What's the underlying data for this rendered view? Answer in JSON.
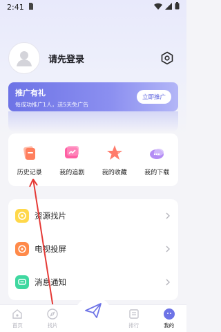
{
  "status_bar": {
    "time": "2:41"
  },
  "profile": {
    "login_text": "请先登录"
  },
  "promo": {
    "title": "推广有礼",
    "subtitle": "每成功推广1人，送5天免广告",
    "button": "立即推广"
  },
  "quick_actions": [
    {
      "label": "历史记录",
      "icon": "history-icon"
    },
    {
      "label": "我的追剧",
      "icon": "follow-icon"
    },
    {
      "label": "我的收藏",
      "icon": "star-icon"
    },
    {
      "label": "我的下载",
      "icon": "download-icon"
    }
  ],
  "menu": [
    {
      "label": "资源找片",
      "icon": "resource-search-icon"
    },
    {
      "label": "电视投屏",
      "icon": "tv-cast-icon"
    },
    {
      "label": "消息通知",
      "icon": "message-icon"
    }
  ],
  "tabbar": {
    "tabs": [
      {
        "label": "首页",
        "icon": "home-icon"
      },
      {
        "label": "找片",
        "icon": "compass-icon"
      },
      {
        "label": "",
        "icon": "paper-plane-icon"
      },
      {
        "label": "排行",
        "icon": "ranking-icon"
      },
      {
        "label": "我的",
        "icon": "profile-icon"
      }
    ],
    "active_index": 4
  },
  "colors": {
    "accent": "#6d73e6",
    "promo_end": "#b3b6f7",
    "annotation_red": "#e53935"
  }
}
